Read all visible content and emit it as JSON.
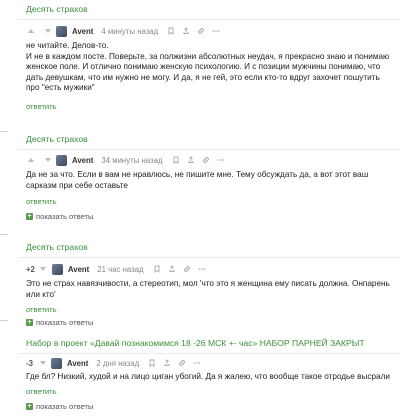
{
  "comments": [
    {
      "post_title": "Десять страхов",
      "vote": "",
      "author": "Avent",
      "time": "4 минуты назад",
      "text": "не читайте. Делов-то.\nИ не в каждом посте. Поверьте, за полжизни абсолютных неудач, я прекрасно знаю и понимаю женское поле. И отлично понимаю женскую психологию. И с позиции мужчины понимаю, что дать девушкам, что им нужно не могу. И да, я не гей, это если кто-то вдруг захочет пошутить про \"есть мужики\"",
      "reply_label": "ответить"
    },
    {
      "post_title": "Десять страхов",
      "vote": "",
      "author": "Avent",
      "time": "34 минуты назад",
      "text": "Да не за что. Если в вам не нравлюсь, не пишите мне. Тему обсуждать да, а вот этот ваш сарказм при себе оставьте",
      "reply_label": "ответить",
      "show_replies": "показать ответы"
    },
    {
      "post_title": "Десять страхов",
      "vote": "+2",
      "author": "Avent",
      "time": "21 час назад",
      "text": "Это не страх навязчивости, а стереотип, мол 'что это я женщина ему писать должна. Онпарень или кто'",
      "reply_label": "ответить",
      "show_replies": "показать ответы"
    },
    {
      "post_title": "Набор в проект «Давай познакомимся 18 -26 МСК +- час» НАБОР ПАРНЕЙ ЗАКРЫТ",
      "vote": "-3",
      "author": "Avent",
      "time": "2 дня назад",
      "text": "Где бл? Низкий, худой и на лицо циган убогий. Да я жалею, что вообще такое отродье высрали",
      "reply_label": "ответить",
      "show_replies": "показать ответы"
    }
  ],
  "colors": {
    "link_green": "#3a8f3a",
    "badge_green": "#5a9a4a"
  }
}
